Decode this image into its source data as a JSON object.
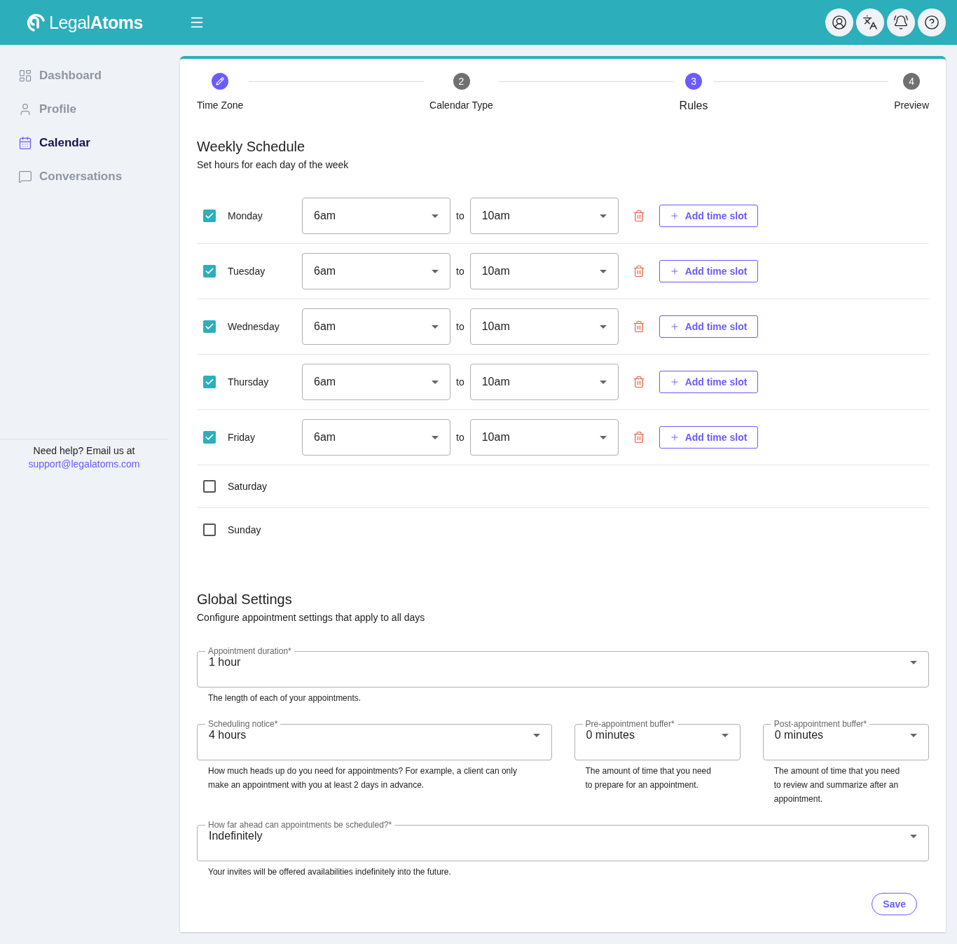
{
  "header": {
    "logo": "Legal**Atoms**"
  },
  "sidebar": {
    "items": [
      {
        "label": "Dashboard",
        "selected": false
      },
      {
        "label": "Profile",
        "selected": false
      },
      {
        "label": "Calendar",
        "selected": true
      },
      {
        "label": "Conversations",
        "selected": false
      }
    ],
    "help_text": "Need help? Email us at",
    "help_email": "support@legalatoms.com"
  },
  "stepper": [
    {
      "label": "Time Zone",
      "completed": true,
      "selected": false
    },
    {
      "number": "2",
      "label": "Calendar Type",
      "completed": false,
      "selected": false
    },
    {
      "number": "3",
      "label": "Rules",
      "completed": false,
      "selected": true
    },
    {
      "number": "4",
      "label": "Preview",
      "completed": false,
      "selected": false
    }
  ],
  "weekly_schedule": {
    "title": "Weekly Schedule",
    "subtitle": "Set hours for each day of the week",
    "days": [
      {
        "day": "Monday",
        "checked": true,
        "from": "6am",
        "to_label": "to",
        "to": "10am",
        "add_button": "Add time slot"
      },
      {
        "day": "Tuesday",
        "checked": true,
        "from": "6am",
        "to_label": "to",
        "to": "10am",
        "add_button": "Add time slot"
      },
      {
        "day": "Wednesday",
        "checked": true,
        "from": "6am",
        "to_label": "to",
        "to": "10am",
        "add_button": "Add time slot"
      },
      {
        "day": "Thursday",
        "checked": true,
        "from": "6am",
        "to_label": "to",
        "to": "10am",
        "add_button": "Add time slot"
      },
      {
        "day": "Friday",
        "checked": true,
        "from": "6am",
        "to_label": "to",
        "to": "10am",
        "add_button": "Add time slot"
      },
      {
        "day": "Saturday",
        "checked": false
      },
      {
        "day": "Sunday",
        "checked": false
      }
    ]
  },
  "global_settings": {
    "title": "Global Settings",
    "subtitle": "Configure appointment settings that apply to all days",
    "fields": [
      {
        "kind": "full",
        "label": "Appointment duration*",
        "value": "1 hour",
        "helper": "The length of each of your appointments."
      },
      {
        "kind": "wide",
        "label": "Scheduling notice*",
        "value": "4 hours",
        "helper": "How much heads up do you need for appointments? For example, a client can only make an appointment with you at least 2 days in advance."
      },
      {
        "kind": "narrow",
        "label": "Pre-appointment buffer*",
        "value": "0 minutes",
        "helper": "The amount of time that you need to prepare for an appointment."
      },
      {
        "kind": "narrow",
        "label": "Post-appointment buffer*",
        "value": "0 minutes",
        "helper": "The amount of time that you need to review and summarize after an appointment."
      },
      {
        "kind": "full",
        "label": "How far ahead can appointments be scheduled?*",
        "value": "Indefinitely",
        "helper": "Your invites will be offered availabilities indefinitely into the future."
      }
    ]
  },
  "save_button": "Save"
}
